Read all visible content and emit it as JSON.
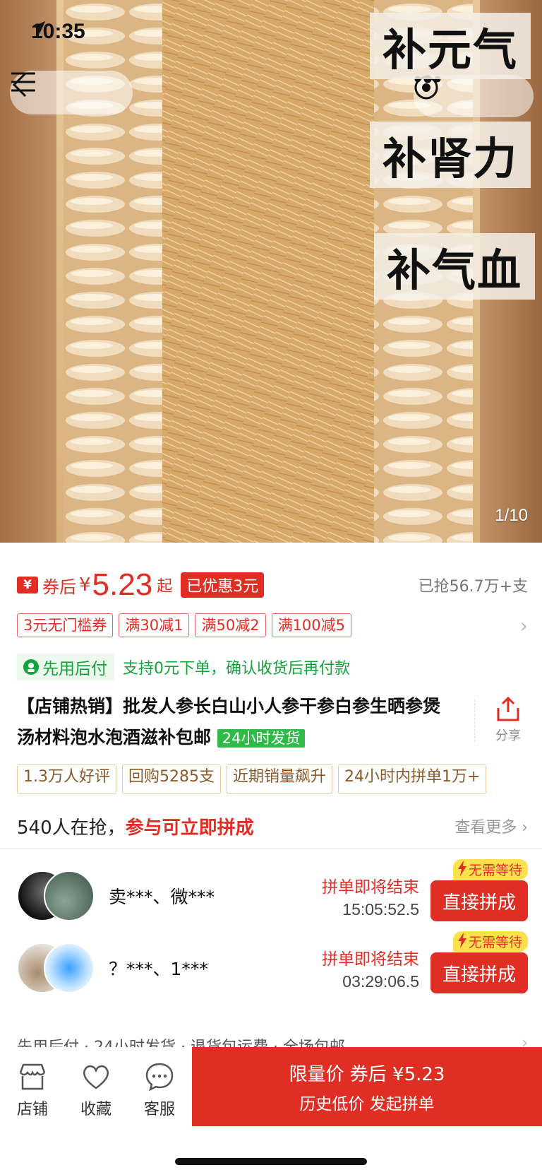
{
  "status_bar": {
    "time": "10:35"
  },
  "hero": {
    "overlay_texts": [
      "补元气",
      "补肾力",
      "补气血"
    ],
    "counter": "1/10"
  },
  "price": {
    "badge": "¥",
    "after_label": "券后",
    "currency": "¥",
    "amount": "5.23",
    "suffix": "起",
    "saved": "已优惠3元",
    "sold": "已抢56.7万+支"
  },
  "coupons": [
    "3元无门槛券",
    "满30减1",
    "满50减2",
    "满100减5"
  ],
  "pay_later": {
    "badge": "先用后付",
    "text": "支持0元下单，确认收货后再付款"
  },
  "title": {
    "text": "【店铺热销】批发人参长白山小人参干参白参生晒参煲汤材料泡水泡酒滋补包邮",
    "ship_tag": "24小时发货",
    "share_label": "分享"
  },
  "tags": [
    "1.3万人好评",
    "回购5285支",
    "近期销量飙升",
    "24小时内拼单1万+"
  ],
  "grabbing": {
    "count_text": "540人在抢，",
    "cta_text": "参与可立即拼成",
    "more": "查看更多"
  },
  "groups": [
    {
      "names": "卖***、微***",
      "label": "拼单即将结束",
      "time": "15:05:52.5",
      "badge": "无需等待",
      "button": "直接拼成"
    },
    {
      "names": "？***、1***",
      "label": "拼单即将结束",
      "time": "03:29:06.5",
      "badge": "无需等待",
      "button": "直接拼成"
    }
  ],
  "services": "先用后付 · 24小时发货 · 退货包运费 · 全场包邮",
  "bottom_bar": {
    "store": "店铺",
    "favorite": "收藏",
    "service": "客服",
    "buy_line1": "限量价  券后 ¥5.23",
    "buy_line2": "历史低价 发起拼单"
  },
  "colors": {
    "accent": "#e02e24",
    "green": "#12a33a",
    "yellow": "#ffe14d"
  }
}
